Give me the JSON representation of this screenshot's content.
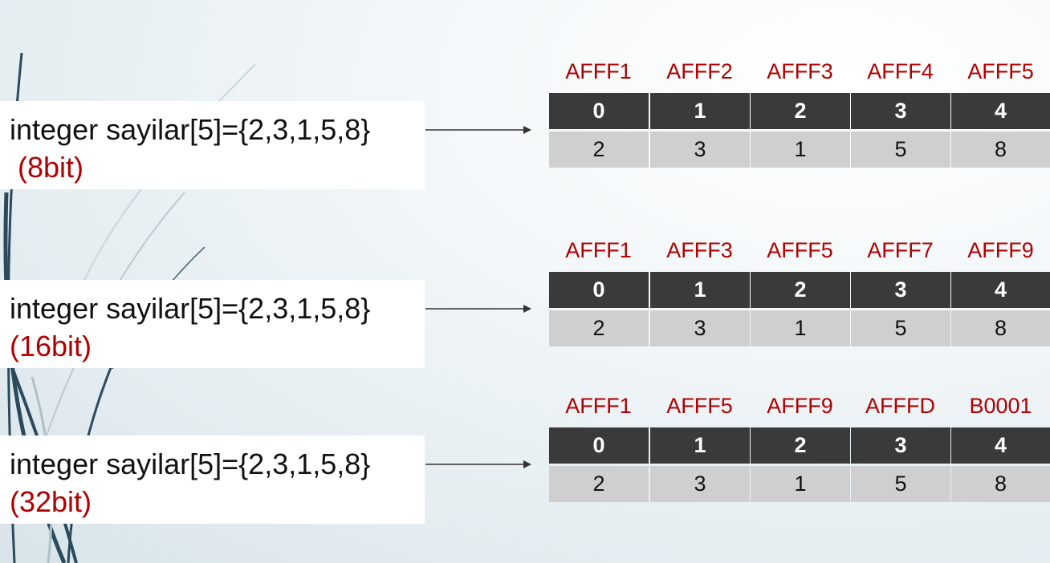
{
  "diagram": {
    "rows": [
      {
        "declaration": "integer sayilar[5]={2,3,1,5,8}",
        "bits": " (8bit)",
        "addresses": [
          "AFFF1",
          "AFFF2",
          "AFFF3",
          "AFFF4",
          "AFFF5"
        ],
        "indices": [
          "0",
          "1",
          "2",
          "3",
          "4"
        ],
        "values": [
          "2",
          "3",
          "1",
          "5",
          "8"
        ]
      },
      {
        "declaration": "integer sayilar[5]={2,3,1,5,8}",
        "bits": "(16bit)",
        "addresses": [
          "AFFF1",
          "AFFF3",
          "AFFF5",
          "AFFF7",
          "AFFF9"
        ],
        "indices": [
          "0",
          "1",
          "2",
          "3",
          "4"
        ],
        "values": [
          "2",
          "3",
          "1",
          "5",
          "8"
        ]
      },
      {
        "declaration": "integer sayilar[5]={2,3,1,5,8}",
        "bits": "(32bit)",
        "addresses": [
          "AFFF1",
          "AFFF5",
          "AFFF9",
          "AFFFD",
          "B0001"
        ],
        "indices": [
          "0",
          "1",
          "2",
          "3",
          "4"
        ],
        "values": [
          "2",
          "3",
          "1",
          "5",
          "8"
        ]
      }
    ]
  },
  "colors": {
    "address_text": "#b00000",
    "bits_text": "#b00000",
    "index_cell_bg": "#3a3a3a",
    "value_cell_bg": "#cfcfcf"
  }
}
